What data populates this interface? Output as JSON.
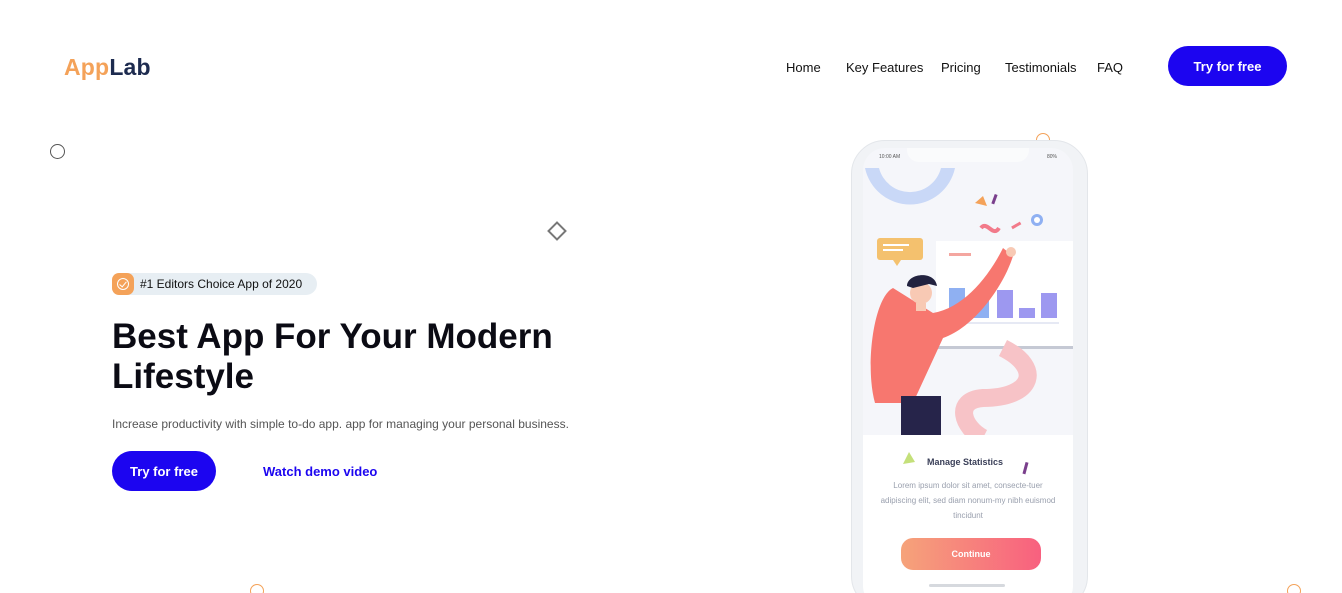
{
  "header": {
    "logo_part1": "App",
    "logo_part2": "Lab",
    "nav": [
      "Home",
      "Key Features",
      "Pricing",
      "Testimonials",
      "FAQ"
    ],
    "cta_label": "Try for free"
  },
  "hero": {
    "badge_text": "#1 Editors Choice App of 2020",
    "title": "Best App For Your Modern Lifestyle",
    "subtitle": "Increase productivity with simple to-do app. app for managing your personal business.",
    "primary_cta": "Try for free",
    "secondary_cta": "Watch demo video"
  },
  "phone": {
    "status_time": "10:00 AM",
    "status_battery": "80%",
    "card_title": "Manage Statistics",
    "card_text": "Lorem ipsum dolor sit amet, consecte-tuer adipiscing elit, sed diam nonum-my nibh euismod tincidunt",
    "card_button": "Continue"
  },
  "colors": {
    "brand_blue": "#1c05f0",
    "logo_orange": "#f4a259",
    "logo_navy": "#1d2b4f"
  }
}
